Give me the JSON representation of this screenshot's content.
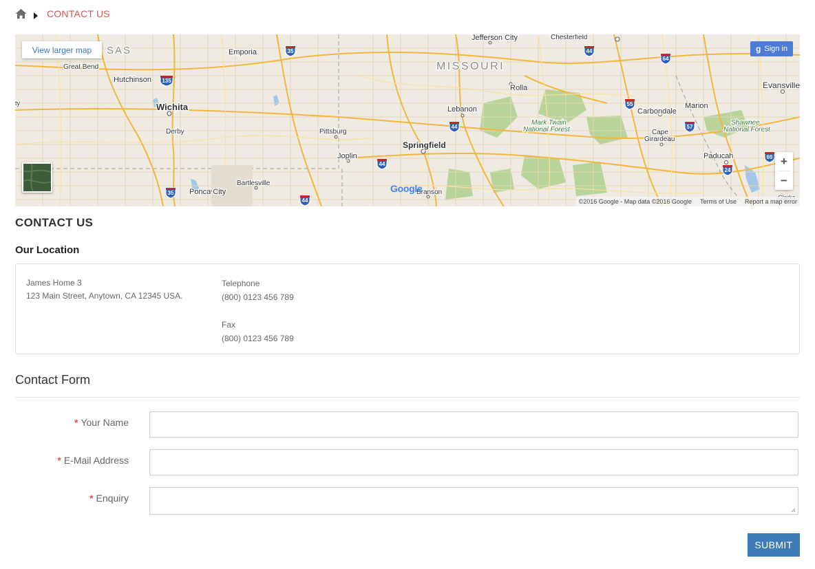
{
  "breadcrumb": {
    "current": "CONTACT US"
  },
  "map": {
    "larger_map": "View larger map",
    "sign_in": "Sign in",
    "sign_in_glyph": "g",
    "zoom_in": "+",
    "zoom_out": "−",
    "logo": "Google",
    "attribution": "©2016 Google - Map data ©2016 Google",
    "terms": "Terms of Use",
    "report": "Report a map error",
    "labels": {
      "sas": "SAS",
      "great_bend": "Great Bend",
      "hutchinson": "Hutchinson",
      "emporia": "Emporia",
      "jefferson_city": "Jefferson City",
      "chesterfield": "Chesterfield",
      "missouri": "MISSOURI",
      "rolla": "Rolla",
      "evansville": "Evansville",
      "wichita": "Wichita",
      "lebanon": "Lebanon",
      "carbondale": "Carbondale",
      "marion": "Marion",
      "mark_twain": "Mark Twain",
      "national_forest": "National Forest",
      "shawnee": "Shawnee",
      "shawnee_forest": "National Forest",
      "derby": "Derby",
      "pittsburg": "Pittsburg",
      "springfield": "Springfield",
      "cape_girardeau_1": "Cape",
      "cape_girardeau_2": "Girardeau",
      "joplin": "Joplin",
      "paducah": "Paducah",
      "bartlesville": "Bartlesville",
      "ponca_city": "Ponca City",
      "branson": "Branson",
      "clarks": "Clarks",
      "edge_left": "ty"
    },
    "shields": {
      "i35a": "35",
      "i135": "135",
      "i44a": "44",
      "i64": "64",
      "i55": "55",
      "i44b": "44",
      "i57": "57",
      "i44c": "44",
      "i69": "69",
      "i24": "24",
      "i35b": "35",
      "i44d": "44"
    }
  },
  "page_title": "CONTACT US",
  "location": {
    "heading": "Our Location",
    "name": "James Home 3",
    "address": "123 Main Street, Anytown, CA 12345 USA.",
    "telephone_label": "Telephone",
    "telephone": "(800) 0123 456 789",
    "fax_label": "Fax",
    "fax": "(800) 0123 456 789"
  },
  "form": {
    "heading": "Contact Form",
    "required_mark": "*",
    "name_label": "Your Name",
    "email_label": "E-Mail Address",
    "enquiry_label": "Enquiry",
    "name_value": "",
    "email_value": "",
    "enquiry_value": "",
    "submit": "SUBMIT"
  }
}
